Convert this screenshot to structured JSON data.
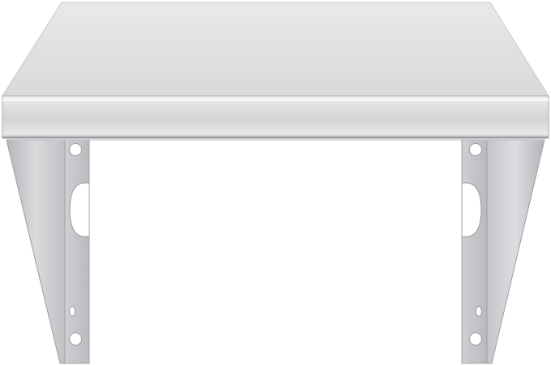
{
  "image": {
    "subject": "stainless-steel-wall-shelf",
    "background_color": "#ffffff",
    "colors": {
      "steel_light": "#eeeeef",
      "steel_mid": "#d7d8da",
      "steel_dark": "#a9abae",
      "edge_highlight": "#f7f7f7",
      "edge_shadow": "#8e9093"
    }
  }
}
